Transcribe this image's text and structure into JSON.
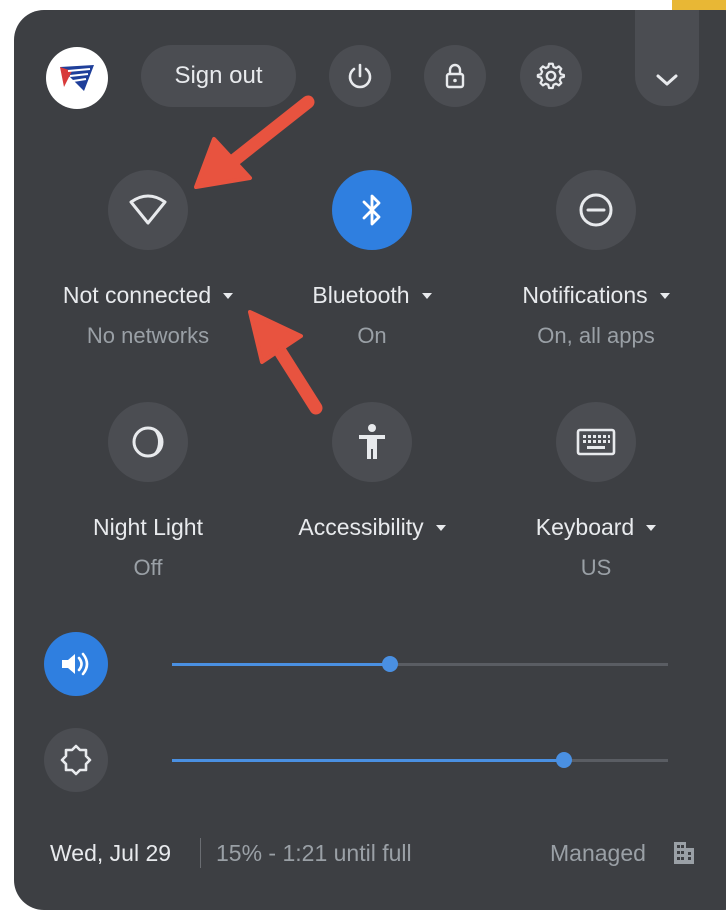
{
  "header": {
    "sign_out_label": "Sign out",
    "power_icon": "power-icon",
    "lock_icon": "lock-icon",
    "settings_icon": "gear-icon",
    "collapse_icon": "chevron-down-icon"
  },
  "tiles": [
    {
      "id": "network",
      "icon": "wifi-outline-icon",
      "label": "Not connected",
      "sub": "No networks",
      "has_menu": true,
      "active": false
    },
    {
      "id": "bluetooth",
      "icon": "bluetooth-icon",
      "label": "Bluetooth",
      "sub": "On",
      "has_menu": true,
      "active": true
    },
    {
      "id": "notifications",
      "icon": "do-not-disturb-icon",
      "label": "Notifications",
      "sub": "On, all apps",
      "has_menu": true,
      "active": false
    },
    {
      "id": "night-light",
      "icon": "night-light-icon",
      "label": "Night Light",
      "sub": "Off",
      "has_menu": false,
      "active": false
    },
    {
      "id": "accessibility",
      "icon": "accessibility-icon",
      "label": "Accessibility",
      "sub": "",
      "has_menu": true,
      "active": false
    },
    {
      "id": "keyboard",
      "icon": "keyboard-icon",
      "label": "Keyboard",
      "sub": "US",
      "has_menu": true,
      "active": false
    }
  ],
  "sliders": {
    "volume": {
      "icon": "volume-icon",
      "level": 0.44
    },
    "brightness": {
      "icon": "brightness-icon",
      "level": 0.79
    }
  },
  "footer": {
    "date": "Wed, Jul 29",
    "battery": "15% - 1:21 until full",
    "managed": "Managed"
  },
  "colors": {
    "panel": "#3d3f43",
    "button": "#4b4d52",
    "accent": "#2f7fe0",
    "annotation_arrow": "#e8533f"
  }
}
